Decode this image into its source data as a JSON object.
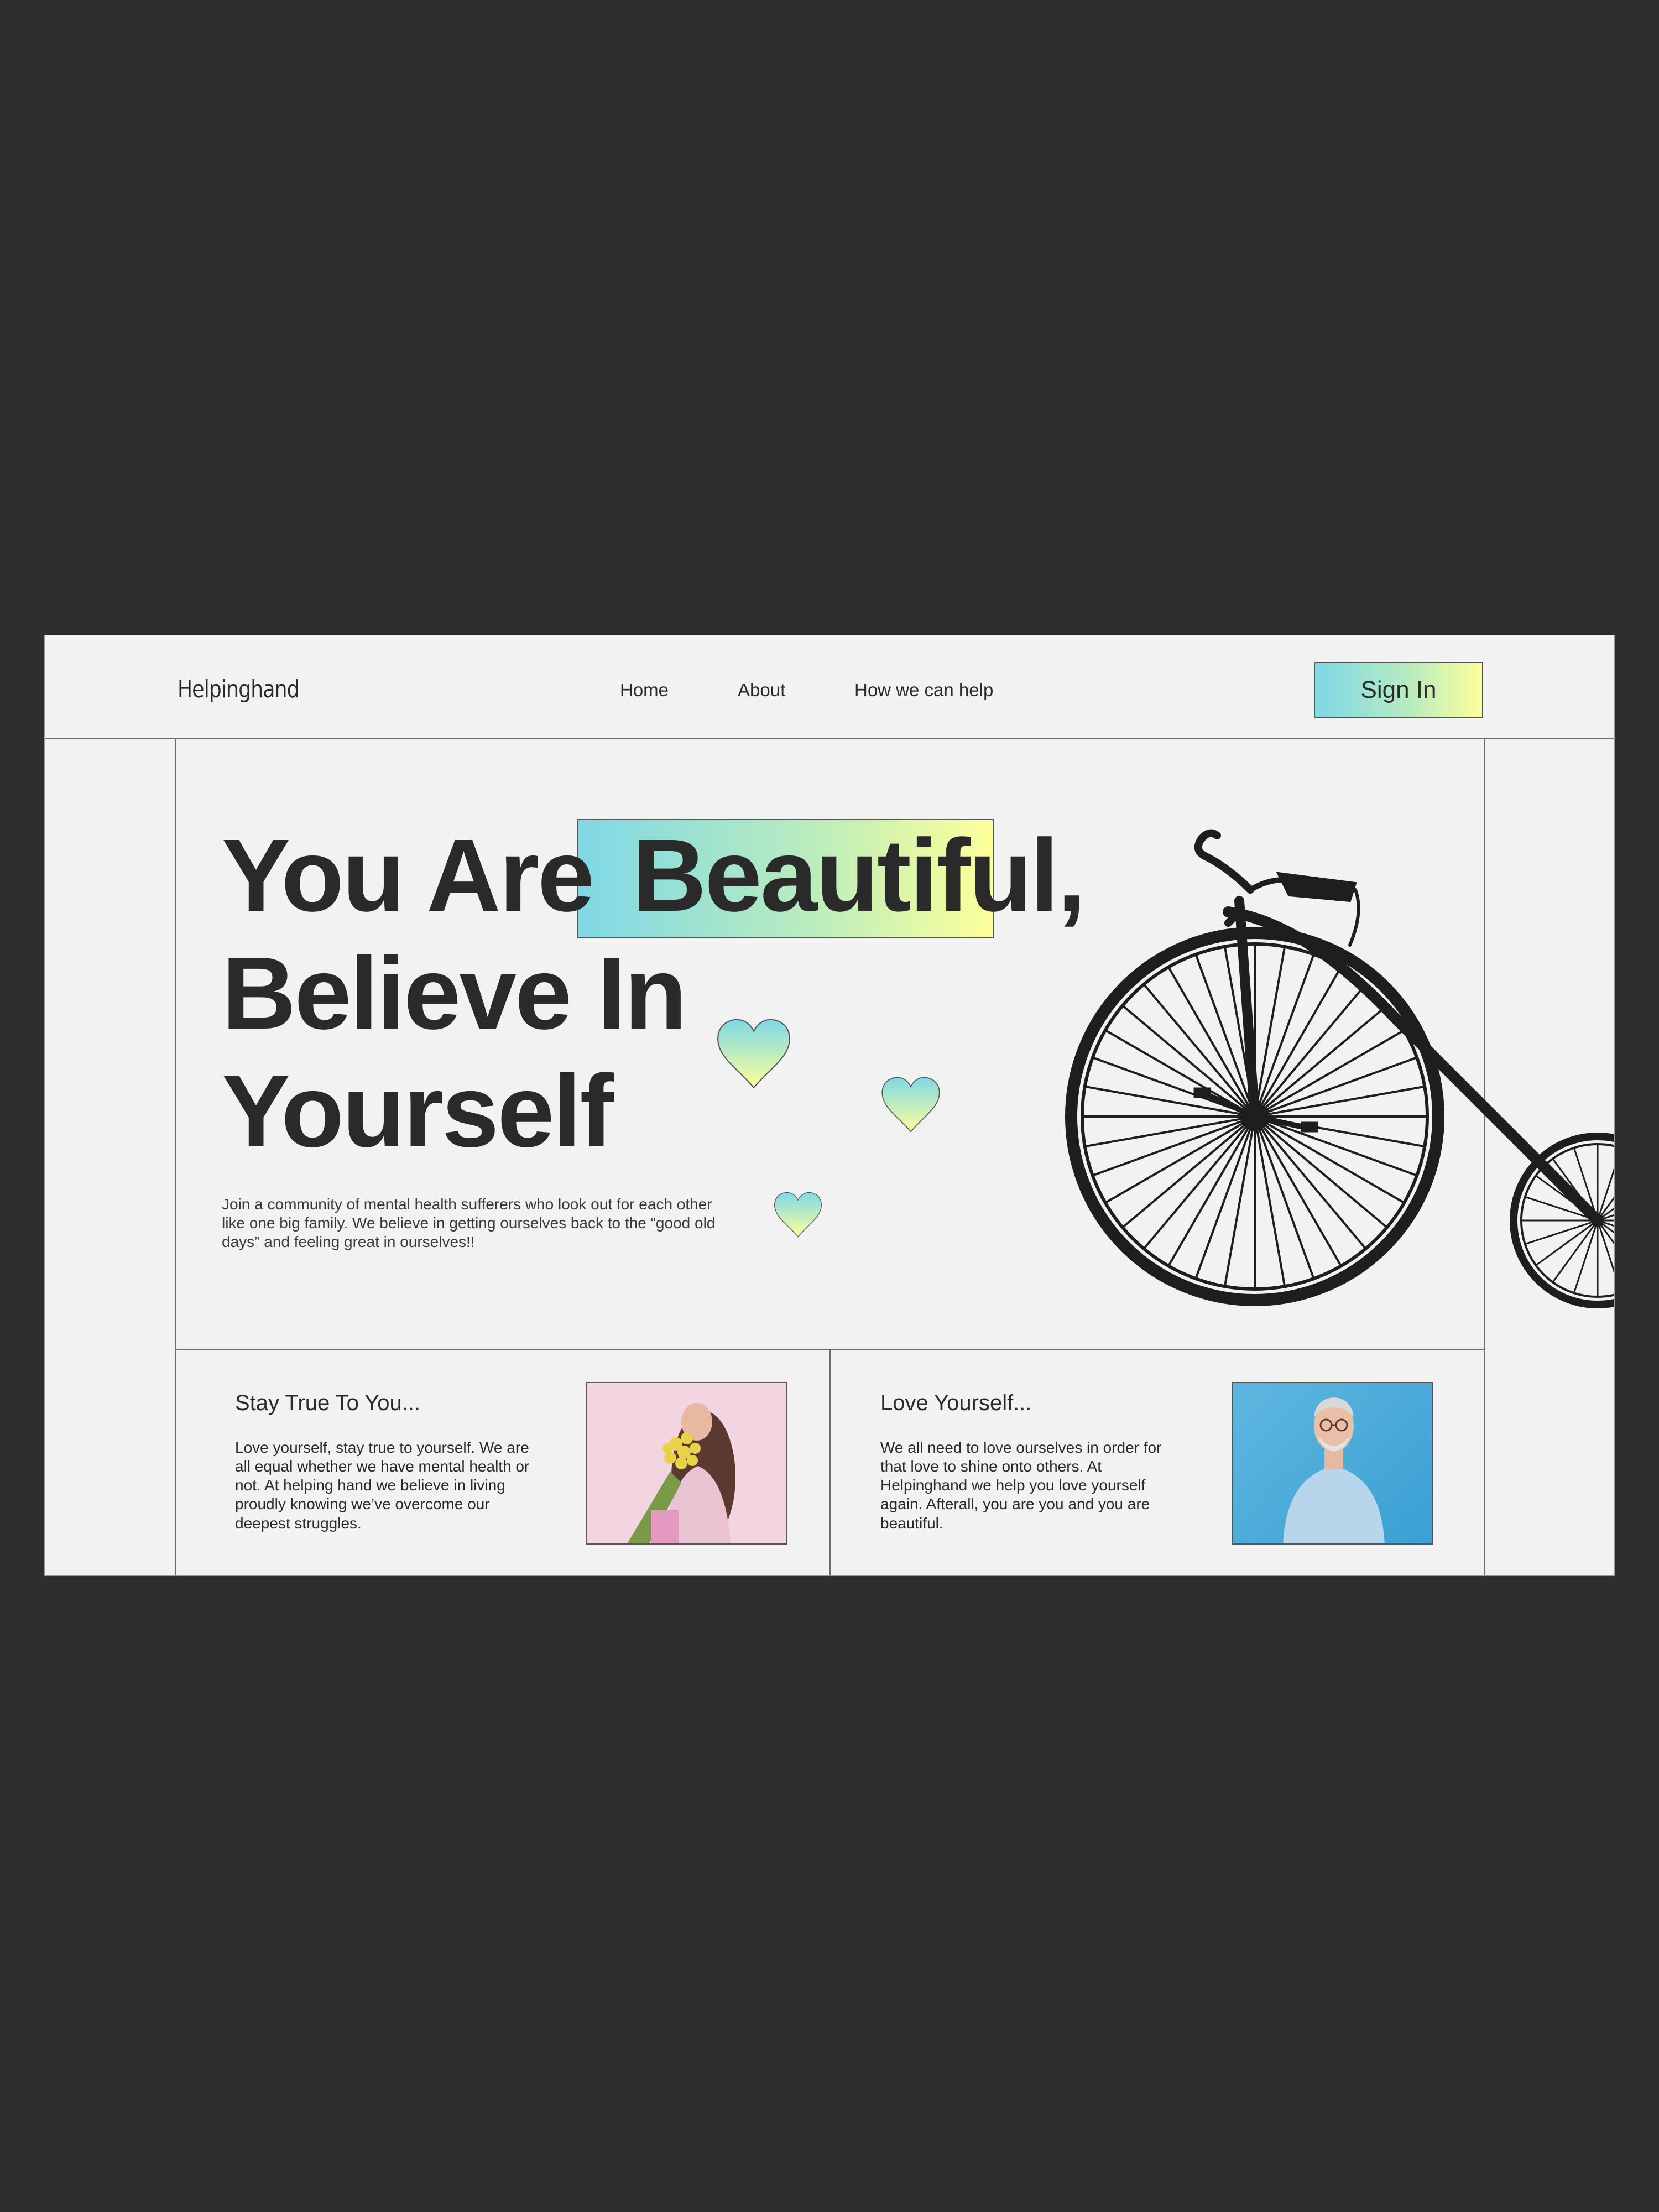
{
  "header": {
    "logo": "Helpinghand",
    "nav": [
      "Home",
      "About",
      "How we can help"
    ],
    "signin_label": "Sign In"
  },
  "hero": {
    "line1_a": "You Are ",
    "line1_highlight": "Beautiful",
    "line1_b": ",",
    "line2": "Believe In",
    "line3": "Yourself",
    "description": "Join a community of mental health sufferers who look out for each other like one big family. We believe in getting ourselves back to the “good old days” and feeling great in ourselves!!"
  },
  "cards": [
    {
      "title": "Stay True To You...",
      "text": "Love yourself, stay true to yourself. We are all equal whether we have mental health or not. At helping hand we believe in living proudly knowing we’ve overcome our deepest struggles."
    },
    {
      "title": "Love Yourself...",
      "text": "We all need to love ourselves in order for that love to shine onto others. At Helpinghand we help you love yourself again. Afterall, you are you and you are beautiful."
    }
  ],
  "colors": {
    "background": "#2e2e2e",
    "page": "#f2f2f2",
    "gradient_start": "#7fd8e6",
    "gradient_end": "#fdff9a",
    "text": "#2a2a2a"
  },
  "icons": [
    "heart-icon",
    "penny-farthing-bicycle-illustration"
  ]
}
